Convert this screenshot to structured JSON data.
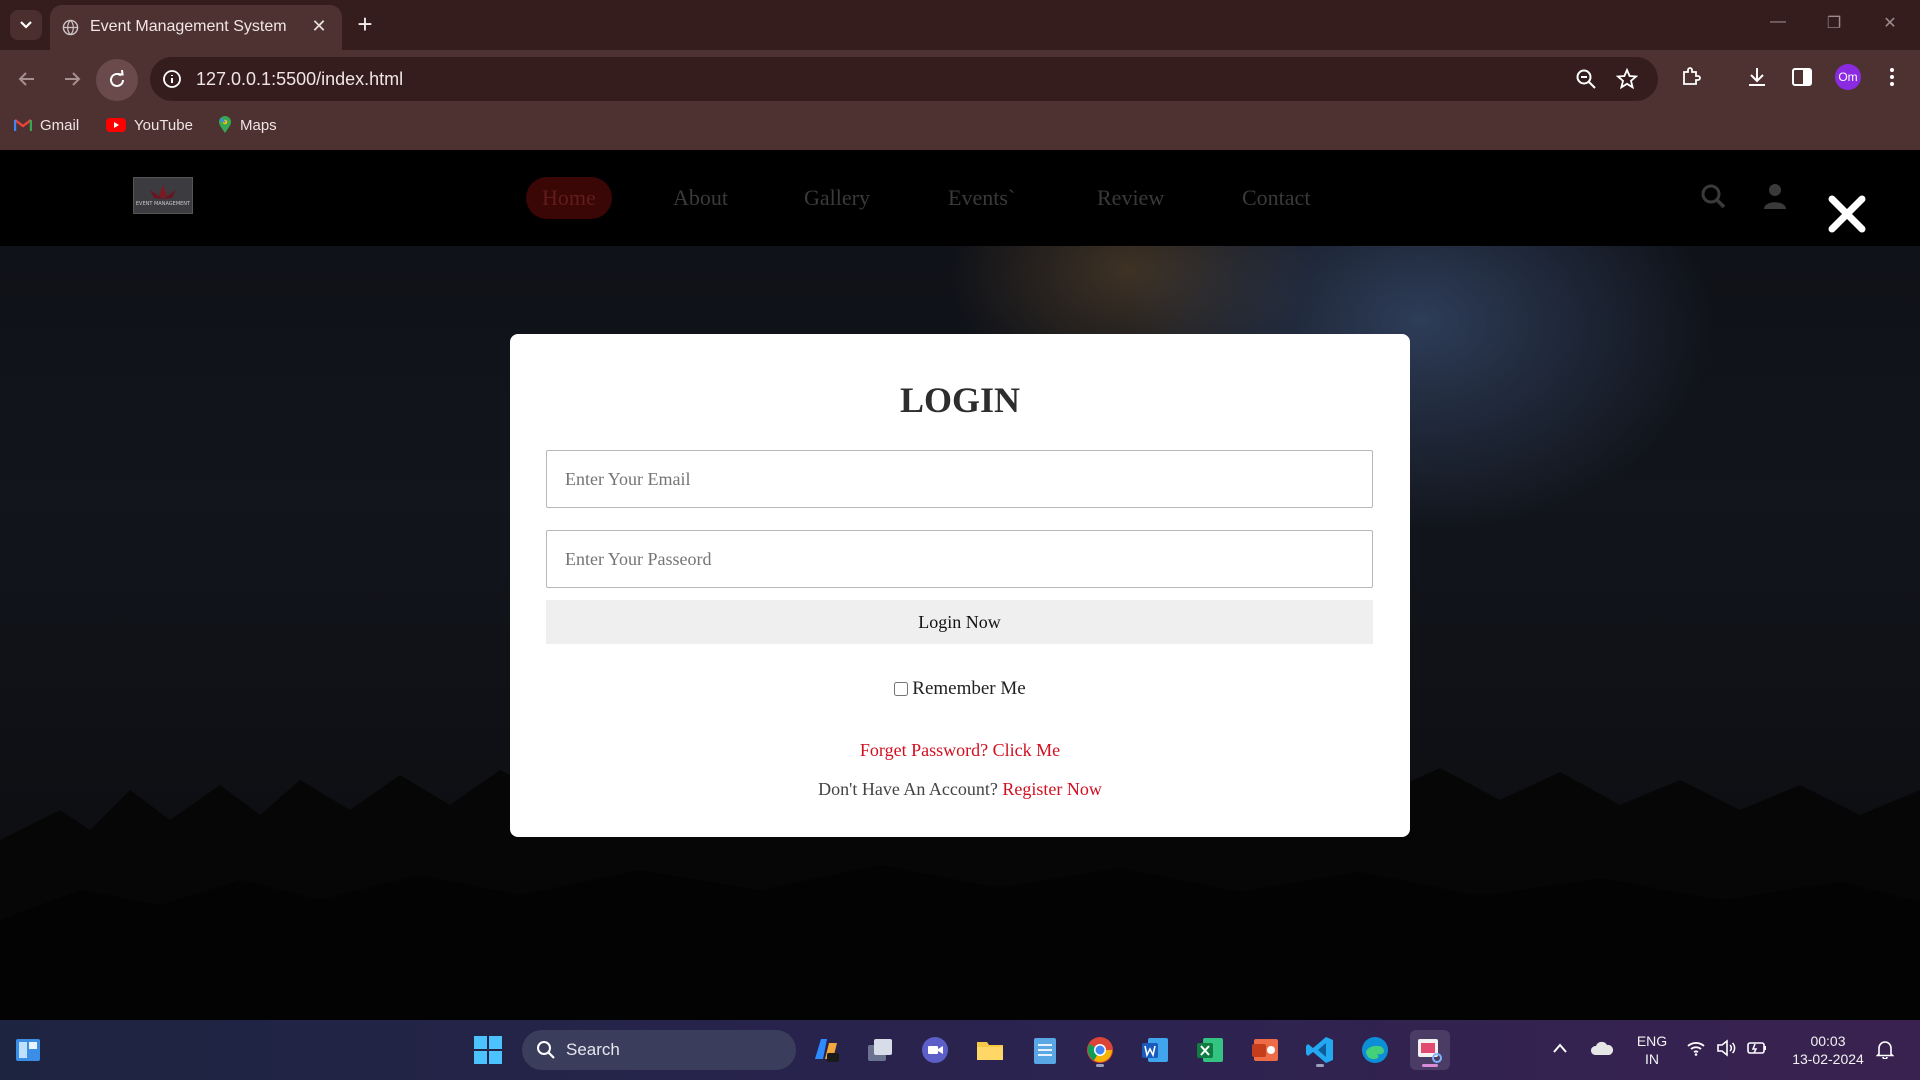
{
  "browser": {
    "tab": {
      "title": "Event Management System"
    },
    "url": "127.0.0.1:5500/index.html",
    "profile_initials": "Om",
    "bookmarks": [
      {
        "label": "Gmail",
        "icon": "gmail-icon"
      },
      {
        "label": "YouTube",
        "icon": "youtube-icon"
      },
      {
        "label": "Maps",
        "icon": "maps-icon"
      }
    ]
  },
  "site": {
    "logo_text": "EVENT MANAGEMENT",
    "nav": [
      {
        "label": "Home",
        "active": true
      },
      {
        "label": "About"
      },
      {
        "label": "Gallery"
      },
      {
        "label": "Events`"
      },
      {
        "label": "Review"
      },
      {
        "label": "Contact"
      }
    ],
    "icons": [
      "search-icon",
      "user-icon",
      "close-icon"
    ]
  },
  "login": {
    "title": "LOGIN",
    "email_placeholder": "Enter Your Email",
    "password_placeholder": "Enter Your Passeord",
    "button_label": "Login Now",
    "remember_label": "Remember Me",
    "remember_checked": false,
    "forgot_text": "Forget Password? Click Me",
    "register_prompt": "Don't Have An Account?",
    "register_link": "Register Now"
  },
  "taskbar": {
    "search_label": "Search",
    "language": {
      "line1": "ENG",
      "line2": "IN"
    },
    "time": "00:03",
    "date": "13-02-2024"
  },
  "colors": {
    "chrome_dark": "#351d1d",
    "chrome_toolbar": "#4e3232",
    "link_red": "#d10f1f",
    "nav_active_bg": "#3a0606"
  }
}
